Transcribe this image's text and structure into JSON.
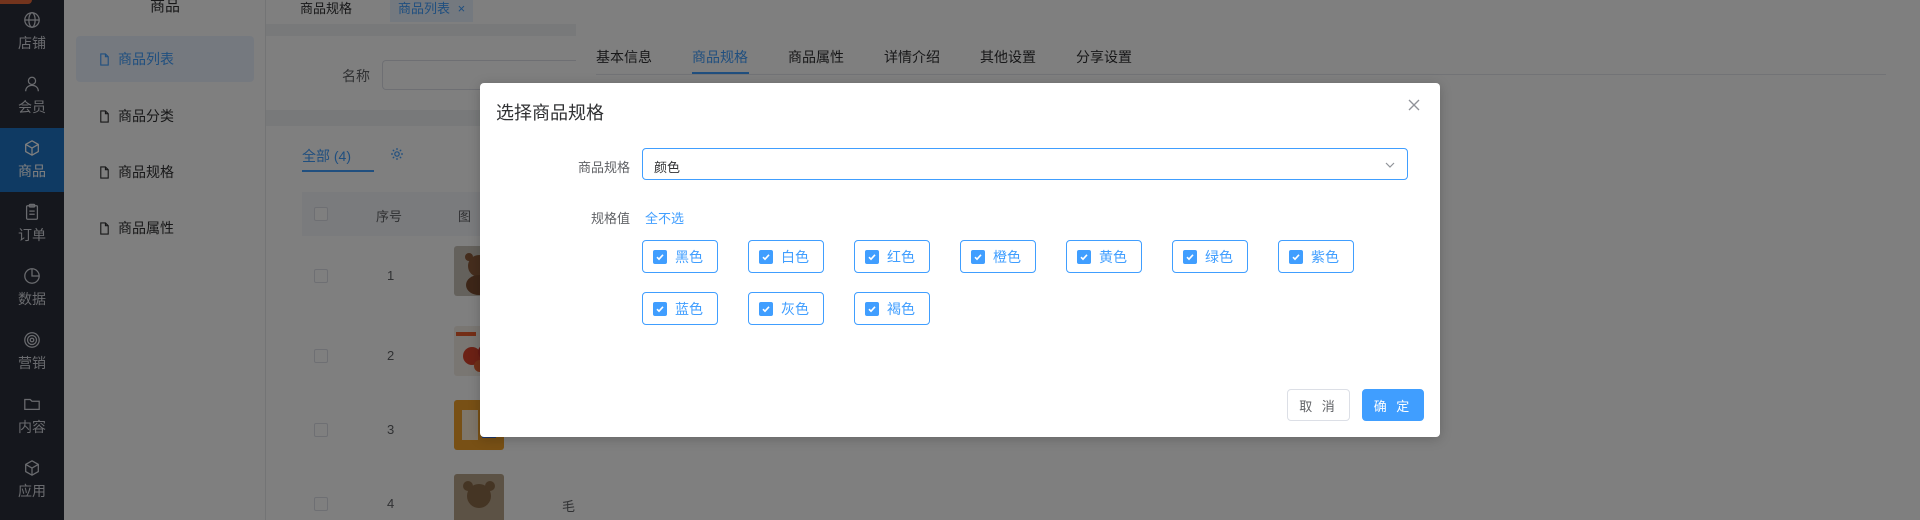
{
  "rail": {
    "items": [
      {
        "label": "店铺",
        "icon": "globe-icon"
      },
      {
        "label": "会员",
        "icon": "user-icon"
      },
      {
        "label": "商品",
        "icon": "cube-icon",
        "active": true
      },
      {
        "label": "订单",
        "icon": "clipboard-icon"
      },
      {
        "label": "数据",
        "icon": "pie-chart-icon"
      },
      {
        "label": "营销",
        "icon": "target-icon"
      },
      {
        "label": "内容",
        "icon": "folder-icon"
      },
      {
        "label": "应用",
        "icon": "box-icon"
      }
    ]
  },
  "submenu": {
    "title": "商品",
    "items": [
      {
        "label": "商品列表",
        "active": true
      },
      {
        "label": "商品分类"
      },
      {
        "label": "商品规格"
      },
      {
        "label": "商品属性"
      }
    ]
  },
  "page_tabs": [
    {
      "label": "商品规格"
    },
    {
      "label": "商品列表",
      "close": "×",
      "active": true
    }
  ],
  "filter": {
    "name_label": "名称"
  },
  "list": {
    "tab_all": "全部 (4)",
    "columns": {
      "index": "序号",
      "image": "图"
    },
    "rows": [
      {
        "index": "1"
      },
      {
        "index": "2"
      },
      {
        "index": "3"
      },
      {
        "index": "4",
        "name_partial": "毛"
      }
    ]
  },
  "drawer": {
    "tabs": [
      "基本信息",
      "商品规格",
      "商品属性",
      "详情介绍",
      "其他设置",
      "分享设置"
    ],
    "active_tab": "商品规格"
  },
  "dialog": {
    "title": "选择商品规格",
    "close_glyph": "×",
    "spec_label": "商品规格",
    "spec_value": "颜色",
    "values_label": "规格值",
    "toggle_all": "全不选",
    "values": [
      "黑色",
      "白色",
      "红色",
      "橙色",
      "黄色",
      "绿色",
      "紫色",
      "蓝色",
      "灰色",
      "褐色"
    ],
    "cancel": "取 消",
    "confirm": "确 定"
  },
  "colors": {
    "primary": "#409eff",
    "rail_bg": "#2b2f3a",
    "rail_active": "#1f74c6"
  }
}
